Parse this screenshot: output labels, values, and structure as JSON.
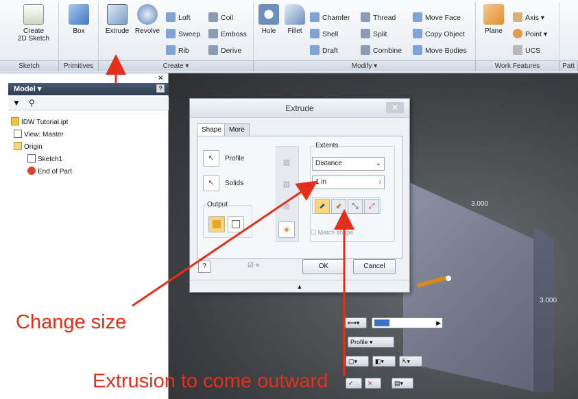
{
  "ribbon": {
    "panels": [
      {
        "label": "Sketch"
      },
      {
        "label": "Primitives"
      },
      {
        "label": "Create ▾"
      },
      {
        "label": "Modify ▾"
      },
      {
        "label": "Work Features"
      },
      {
        "label": "Patt"
      }
    ],
    "create_2d_sketch": {
      "line1": "Create",
      "line2": "2D Sketch"
    },
    "box": "Box",
    "extrude": "Extrude",
    "revolve": "Revolve",
    "loft": "Loft",
    "sweep": "Sweep",
    "rib": "Rib",
    "coil": "Coil",
    "emboss": "Emboss",
    "derive": "Derive",
    "hole": "Hole",
    "fillet": "Fillet",
    "chamfer": "Chamfer",
    "shell": "Shell",
    "draft": "Draft",
    "thread": "Thread",
    "split": "Split",
    "combine": "Combine",
    "move_face": "Move Face",
    "copy_object": "Copy Object",
    "move_bodies": "Move Bodies",
    "plane": "Plane",
    "axis": "Axis ▾",
    "point": "Point ▾",
    "ucs": "UCS"
  },
  "browser": {
    "title": "Model ▾",
    "help": "?",
    "tree": [
      {
        "label": "IDW Tutorial.ipt"
      },
      {
        "label": "View: Master"
      },
      {
        "label": "Origin"
      },
      {
        "label": "Sketch1"
      },
      {
        "label": "End of Part"
      }
    ]
  },
  "dialog": {
    "title": "Extrude",
    "close": "✕",
    "tabs": [
      "Shape",
      "More"
    ],
    "profile": "Profile",
    "solids": "Solids",
    "output": "Output",
    "extents": "Extents",
    "extents_type": "Distance",
    "distance_value": "1 in",
    "match_shape": "Match shape",
    "ok": "OK",
    "cancel": "Cancel"
  },
  "viewport": {
    "dim_top": "3.000",
    "dim_right": "3.000",
    "mini_profile": "Profile"
  },
  "annotations": {
    "change_size": "Change size",
    "extrusion_outward": "Extrusion to come outward"
  },
  "colors": {
    "annotation": "#e4301a",
    "part_face": "#7a7f92",
    "viewport_bg": "#4a4b4e"
  }
}
